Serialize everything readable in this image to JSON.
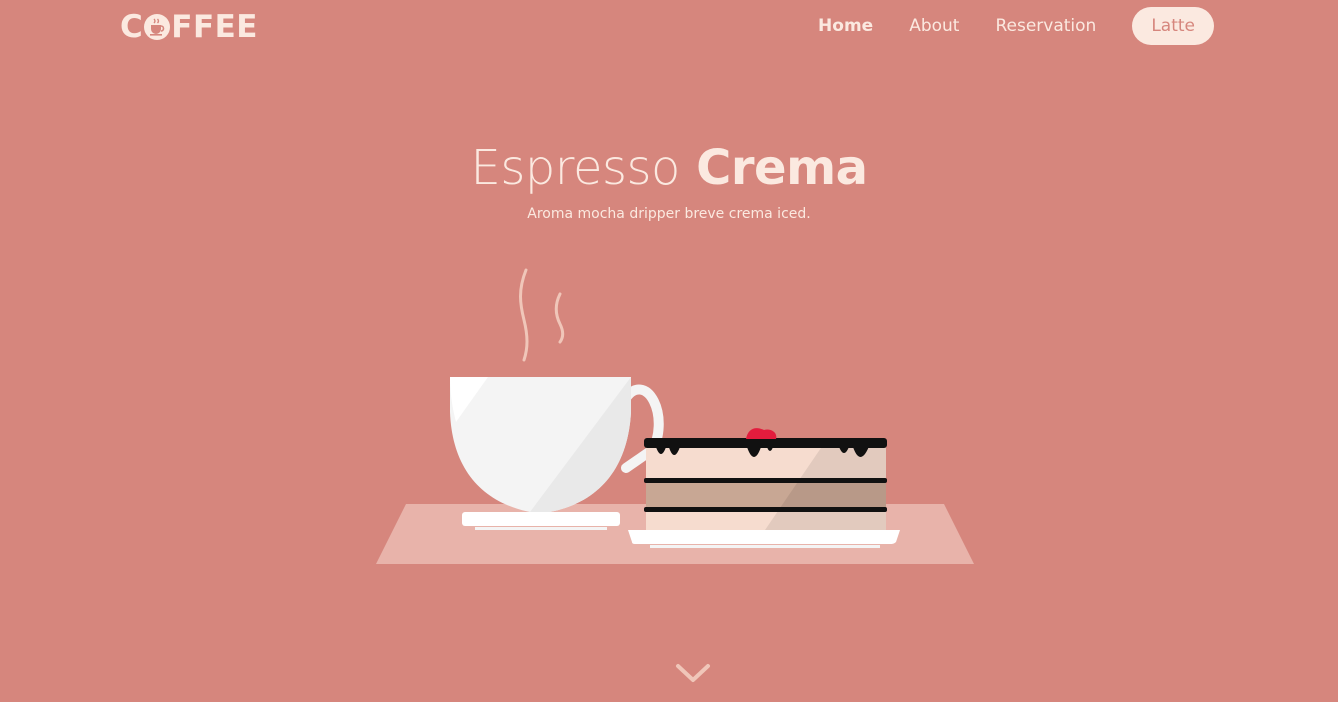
{
  "brand": {
    "logo_text_prefix": "C",
    "logo_text_suffix": "FFEE",
    "logo_mark": "coffee-cup-icon"
  },
  "nav": {
    "items": [
      {
        "label": "Home",
        "active": true
      },
      {
        "label": "About",
        "active": false
      },
      {
        "label": "Reservation",
        "active": false
      }
    ],
    "cta_label": "Latte"
  },
  "hero": {
    "title_light": "Espresso",
    "title_bold": "Crema",
    "subtitle": "Aroma mocha dripper breve crema iced."
  },
  "illustration": {
    "subject": "coffee-cup-and-cake-illustration"
  },
  "scroll": {
    "icon": "chevron-down-icon"
  },
  "colors": {
    "background": "#d6867d",
    "text": "#fbe9e0",
    "table": "#e8b3aa",
    "cup": "#f4f4f4",
    "chocolate": "#111111",
    "cake_light": "#f6dccf",
    "cake_mid": "#c8a794",
    "strawberry": "#e31c3d"
  }
}
